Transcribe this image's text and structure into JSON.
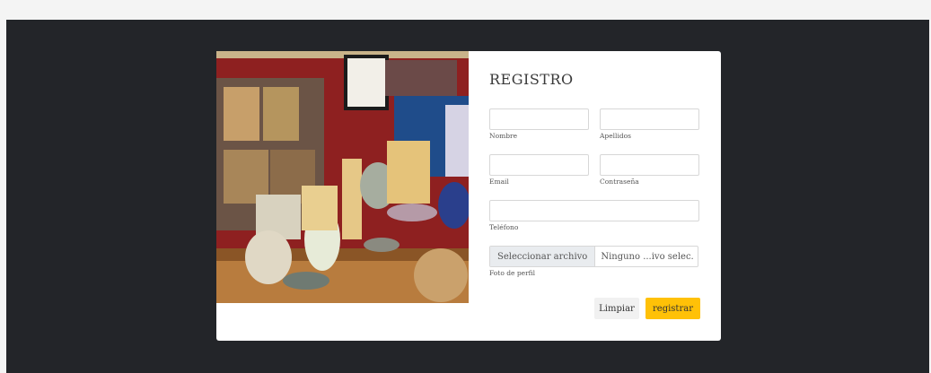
{
  "form": {
    "title": "REGISTRO",
    "fields": {
      "nombre": {
        "label": "Nombre",
        "value": ""
      },
      "apellidos": {
        "label": "Apellidos",
        "value": ""
      },
      "email": {
        "label": "Email",
        "value": ""
      },
      "contrasena": {
        "label": "Contraseña",
        "value": ""
      },
      "telefono": {
        "label": "Teléfono",
        "value": ""
      }
    },
    "photo": {
      "button_label": "Seleccionar archivo",
      "file_name": "Ninguno ...ivo selec.",
      "label": "Foto de perfil"
    },
    "buttons": {
      "clear": "Limpiar",
      "submit": "registrar"
    }
  },
  "colors": {
    "accent": "#ffc107",
    "backdrop": "#232529",
    "card": "#ffffff"
  },
  "image": {
    "subject": "pottery-shelf-photo"
  }
}
